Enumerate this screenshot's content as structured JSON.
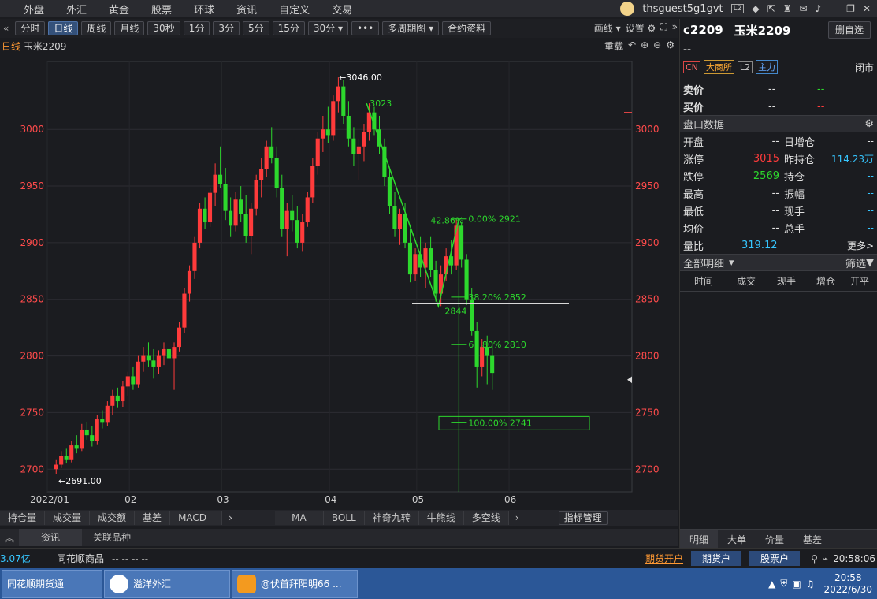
{
  "top_nav": [
    "外盘",
    "外汇",
    "黄金",
    "股票",
    "环球",
    "资讯",
    "自定义",
    "交易"
  ],
  "user": "thsguest5g1gvt",
  "toolbar": {
    "periods": [
      "分时",
      "日线",
      "周线",
      "月线",
      "30秒",
      "1分",
      "3分",
      "5分",
      "15分",
      "30分",
      "多周期图",
      "合约资料"
    ],
    "active": "日线",
    "draw": "画线",
    "settings": "设置"
  },
  "chart_header": {
    "period": "日线",
    "symbol": "玉米2209",
    "reload": "重载"
  },
  "chart_data": {
    "type": "candlestick",
    "title": "",
    "ylim": [
      2680,
      3060
    ],
    "yticks": [
      2700,
      2750,
      2800,
      2850,
      2900,
      2950,
      3000
    ],
    "xticks": [
      "2022/01",
      "02",
      "03",
      "04",
      "05",
      "06"
    ],
    "annotations": {
      "high": "3046.00",
      "low": "2691.00",
      "peak_label": "3023",
      "trough_label": "2844",
      "pct_label": "42.86%"
    },
    "fib_levels": [
      {
        "pct": "0.00%",
        "price": 2921
      },
      {
        "pct": "38.20%",
        "price": 2852
      },
      {
        "pct": "61.80%",
        "price": 2810
      },
      {
        "pct": "100.00%",
        "price": 2741
      }
    ],
    "candles": [
      [
        2700,
        2708,
        2696,
        2704
      ],
      [
        2704,
        2716,
        2701,
        2712
      ],
      [
        2712,
        2718,
        2705,
        2708
      ],
      [
        2708,
        2725,
        2706,
        2721
      ],
      [
        2721,
        2730,
        2714,
        2718
      ],
      [
        2718,
        2740,
        2716,
        2735
      ],
      [
        2735,
        2742,
        2726,
        2730
      ],
      [
        2730,
        2738,
        2720,
        2725
      ],
      [
        2725,
        2748,
        2722,
        2744
      ],
      [
        2744,
        2752,
        2736,
        2741
      ],
      [
        2741,
        2760,
        2738,
        2756
      ],
      [
        2756,
        2770,
        2748,
        2765
      ],
      [
        2765,
        2772,
        2754,
        2760
      ],
      [
        2760,
        2778,
        2755,
        2773
      ],
      [
        2773,
        2786,
        2765,
        2782
      ],
      [
        2782,
        2790,
        2770,
        2775
      ],
      [
        2775,
        2800,
        2772,
        2795
      ],
      [
        2795,
        2808,
        2786,
        2800
      ],
      [
        2800,
        2812,
        2790,
        2796
      ],
      [
        2796,
        2806,
        2780,
        2790
      ],
      [
        2790,
        2805,
        2784,
        2800
      ],
      [
        2800,
        2812,
        2792,
        2806
      ],
      [
        2806,
        2815,
        2794,
        2798
      ],
      [
        2798,
        2812,
        2770,
        2808
      ],
      [
        2808,
        2830,
        2804,
        2825
      ],
      [
        2825,
        2860,
        2820,
        2855
      ],
      [
        2855,
        2880,
        2848,
        2875
      ],
      [
        2875,
        2905,
        2868,
        2900
      ],
      [
        2900,
        2935,
        2895,
        2930
      ],
      [
        2930,
        2940,
        2912,
        2918
      ],
      [
        2918,
        2948,
        2914,
        2944
      ],
      [
        2944,
        2970,
        2932,
        2960
      ],
      [
        2960,
        2985,
        2948,
        2952
      ],
      [
        2952,
        2966,
        2920,
        2928
      ],
      [
        2928,
        2940,
        2905,
        2915
      ],
      [
        2915,
        2945,
        2910,
        2938
      ],
      [
        2938,
        2950,
        2918,
        2925
      ],
      [
        2925,
        2942,
        2900,
        2906
      ],
      [
        2906,
        2935,
        2890,
        2930
      ],
      [
        2930,
        2960,
        2924,
        2955
      ],
      [
        2955,
        2975,
        2940,
        2965
      ],
      [
        2965,
        2990,
        2958,
        2985
      ],
      [
        2985,
        3002,
        2970,
        2975
      ],
      [
        2975,
        2985,
        2940,
        2948
      ],
      [
        2948,
        2960,
        2905,
        2912
      ],
      [
        2912,
        2935,
        2888,
        2928
      ],
      [
        2928,
        2942,
        2910,
        2920
      ],
      [
        2920,
        2932,
        2895,
        2900
      ],
      [
        2900,
        2925,
        2892,
        2918
      ],
      [
        2918,
        2945,
        2914,
        2940
      ],
      [
        2940,
        2975,
        2935,
        2968
      ],
      [
        2968,
        2998,
        2960,
        2992
      ],
      [
        2992,
        3012,
        2980,
        3000
      ],
      [
        3000,
        3020,
        2988,
        2995
      ],
      [
        2995,
        3030,
        2990,
        3025
      ],
      [
        3025,
        3046,
        3015,
        3038
      ],
      [
        3038,
        3044,
        3005,
        3012
      ],
      [
        3012,
        3025,
        2985,
        2992
      ],
      [
        2992,
        3002,
        2968,
        2978
      ],
      [
        2978,
        2992,
        2955,
        2985
      ],
      [
        2985,
        3005,
        2972,
        2998
      ],
      [
        2998,
        3023,
        2990,
        3015
      ],
      [
        3015,
        3020,
        2995,
        3000
      ],
      [
        3000,
        3012,
        2978,
        2985
      ],
      [
        2985,
        2992,
        2950,
        2958
      ],
      [
        2958,
        2966,
        2925,
        2932
      ],
      [
        2932,
        2945,
        2905,
        2912
      ],
      [
        2912,
        2930,
        2898,
        2925
      ],
      [
        2925,
        2935,
        2895,
        2900
      ],
      [
        2900,
        2912,
        2865,
        2872
      ],
      [
        2872,
        2895,
        2866,
        2890
      ],
      [
        2890,
        2905,
        2870,
        2878
      ],
      [
        2878,
        2900,
        2860,
        2895
      ],
      [
        2895,
        2905,
        2870,
        2876
      ],
      [
        2876,
        2884,
        2848,
        2855
      ],
      [
        2855,
        2880,
        2844,
        2872
      ],
      [
        2872,
        2895,
        2866,
        2888
      ],
      [
        2888,
        2902,
        2872,
        2880
      ],
      [
        2880,
        2921,
        2876,
        2915
      ],
      [
        2915,
        2918,
        2878,
        2885
      ],
      [
        2885,
        2890,
        2845,
        2850
      ],
      [
        2850,
        2860,
        2818,
        2822
      ],
      [
        2822,
        2830,
        2772,
        2790
      ],
      [
        2790,
        2815,
        2782,
        2808
      ],
      [
        2808,
        2818,
        2775,
        2800
      ],
      [
        2800,
        2812,
        2770,
        2785
      ]
    ]
  },
  "indicator_tabs_left": [
    "持仓量",
    "成交量",
    "成交额",
    "基差",
    "MACD"
  ],
  "indicator_tabs_right": [
    "MA",
    "BOLL",
    "神奇九转",
    "牛熊线",
    "多空线"
  ],
  "indicator_manage": "指标管理",
  "bottom_tabs": [
    "资讯",
    "关联品种"
  ],
  "right_panel": {
    "code": "c2209",
    "name": "玉米2209",
    "add_watch": "删自选",
    "price": "--",
    "change": "-- --",
    "tags": [
      "CN",
      "大商所",
      "L2",
      "主力"
    ],
    "status": "闭市",
    "sell": {
      "label": "卖价",
      "price": "--",
      "vol": "--"
    },
    "buy": {
      "label": "买价",
      "price": "--",
      "vol": "--"
    },
    "handicap_title": "盘口数据",
    "rows": [
      {
        "l1": "开盘",
        "v1": "--",
        "l2": "日增仓",
        "v2": "--"
      },
      {
        "l1": "涨停",
        "v1": "3015",
        "l2": "昨持仓",
        "v2": "114.23万"
      },
      {
        "l1": "跌停",
        "v1": "2569",
        "l2": "持仓",
        "v2": "--"
      },
      {
        "l1": "最高",
        "v1": "--",
        "l2": "振幅",
        "v2": "--"
      },
      {
        "l1": "最低",
        "v1": "--",
        "l2": "现手",
        "v2": "--"
      },
      {
        "l1": "均价",
        "v1": "--",
        "l2": "总手",
        "v2": "--"
      }
    ],
    "ratio_label": "量比",
    "ratio_value": "319.12",
    "more": "更多>",
    "detail_title": "全部明细",
    "filter": "筛选",
    "detail_cols": [
      "时间",
      "成交",
      "现手",
      "增仓",
      "开平"
    ],
    "bottom_tabs": [
      "明细",
      "大单",
      "价量",
      "基差"
    ]
  },
  "status_bar": {
    "amount": "3.07亿",
    "product": "同花顺商品",
    "placeholders": "-- -- -- --",
    "open_account": "期货开户",
    "futures_acct": "期货户",
    "stock_acct": "股票户",
    "clock": "20:58:06"
  },
  "taskbar": {
    "apps": [
      "同花顺期货通",
      "溢洋外汇",
      "@伏首拜阳明66 ..."
    ],
    "time": "20:58",
    "date": "2022/6/30"
  }
}
